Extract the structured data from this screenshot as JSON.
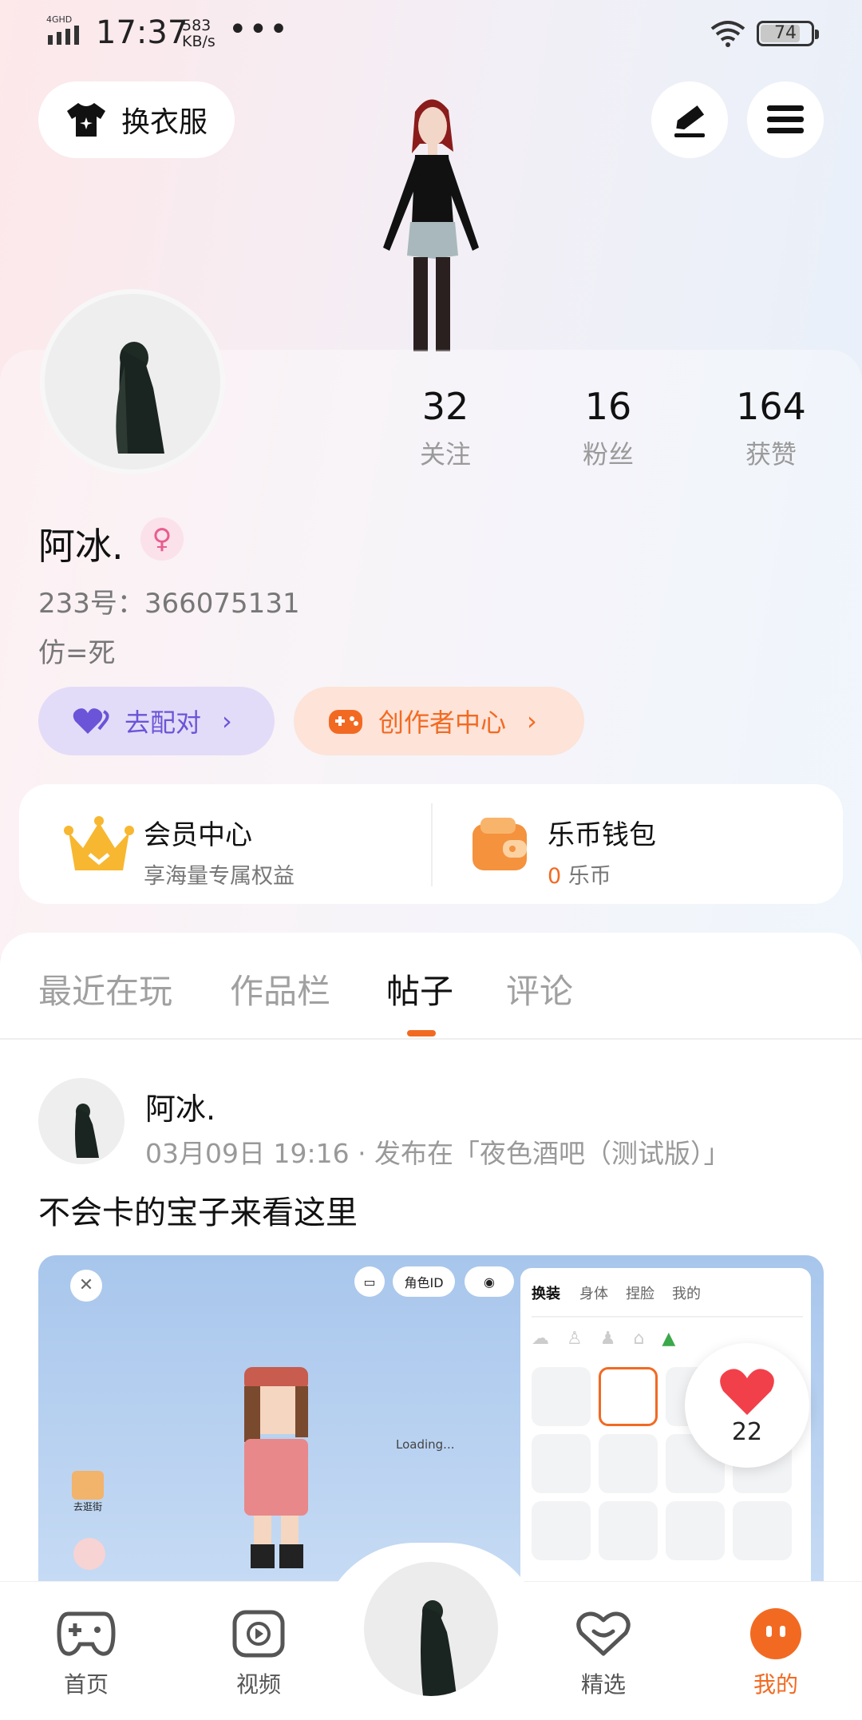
{
  "status_bar": {
    "network": "4GHD",
    "time": "17:37",
    "speed_value": "583",
    "speed_unit": "KB/s",
    "more": "•••",
    "battery": "74"
  },
  "header": {
    "dressup_label": "换衣服",
    "edit_icon": "pen-icon",
    "menu_icon": "hamburger-menu-icon"
  },
  "profile": {
    "stats": [
      {
        "value": "32",
        "label": "关注"
      },
      {
        "value": "16",
        "label": "粉丝"
      },
      {
        "value": "164",
        "label": "获赞"
      }
    ],
    "name": "阿冰.",
    "gender": "female",
    "id_text": "233号：366075131",
    "bio": "仿=死",
    "match_label": "去配对",
    "creator_label": "创作者中心"
  },
  "cards": {
    "vip_title": "会员中心",
    "vip_sub": "享海量专属权益",
    "wallet_title": "乐币钱包",
    "wallet_amount": "0",
    "wallet_unit": "乐币"
  },
  "tabs": [
    "最近在玩",
    "作品栏",
    "帖子",
    "评论"
  ],
  "active_tab": "帖子",
  "post": {
    "author": "阿冰.",
    "meta": "03月09日 19:16 · 发布在「夜色酒吧（测试版）」",
    "content": "不会卡的宝子来看这里",
    "image": {
      "chip_role_id": "角色ID",
      "loading": "Loading...",
      "side_btn_1": "去逛街",
      "tabs": [
        "换装",
        "身体",
        "捏脸",
        "我的"
      ]
    },
    "likes": "22"
  },
  "bottom_nav": [
    {
      "label": "首页",
      "icon": "gamepad-icon"
    },
    {
      "label": "视频",
      "icon": "play-icon"
    },
    {
      "label": "精选",
      "icon": "heart-chat-icon"
    },
    {
      "label": "我的",
      "icon": "smiley-icon"
    }
  ],
  "colors": {
    "accent": "#f26a22",
    "match_purple": "#6c54d8",
    "gold": "#f7b731"
  }
}
